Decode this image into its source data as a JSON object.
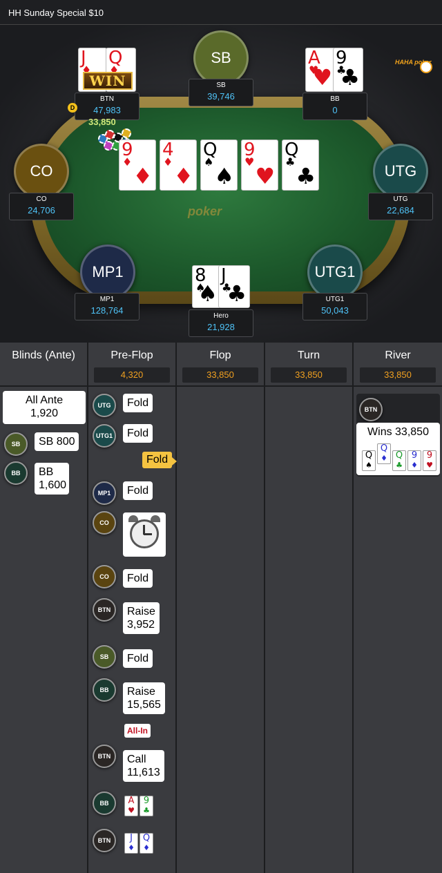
{
  "topbar": {
    "title": "HH  Sunday Special $10"
  },
  "logo": {
    "text": "HAHA poker"
  },
  "table": {
    "watermark": "poker",
    "pot_on_table": "33,850",
    "dealer_label": "D",
    "win_label": "WIN",
    "seats": {
      "btn": {
        "label": "BTN",
        "stack": "47,983"
      },
      "sb": {
        "circle": "SB",
        "label": "SB",
        "stack": "39,746"
      },
      "bb": {
        "label": "BB",
        "stack": "0"
      },
      "co": {
        "circle": "CO",
        "label": "CO",
        "stack": "24,706"
      },
      "utg": {
        "circle": "UTG",
        "label": "UTG",
        "stack": "22,684"
      },
      "mp1": {
        "circle": "MP1",
        "label": "MP1",
        "stack": "128,764"
      },
      "utg1": {
        "circle": "UTG1",
        "label": "UTG1",
        "stack": "50,043"
      },
      "hero": {
        "label": "Hero",
        "stack": "21,928"
      }
    },
    "btn_cards": [
      {
        "rank": "J",
        "suit": "♦"
      },
      {
        "rank": "Q",
        "suit": "♦"
      }
    ],
    "bb_cards": [
      {
        "rank": "A",
        "suit": "♥"
      },
      {
        "rank": "9",
        "suit": "♣"
      }
    ],
    "hero_cards": [
      {
        "rank": "8",
        "suit": "♠"
      },
      {
        "rank": "J",
        "suit": "♣"
      }
    ],
    "board": [
      {
        "rank": "9",
        "suit": "♦"
      },
      {
        "rank": "4",
        "suit": "♦"
      },
      {
        "rank": "Q",
        "suit": "♠"
      },
      {
        "rank": "9",
        "suit": "♥"
      },
      {
        "rank": "Q",
        "suit": "♣"
      }
    ]
  },
  "columns": {
    "blinds": {
      "title": "Blinds (Ante)"
    },
    "preflop": {
      "title": "Pre-Flop",
      "amount": "4,320"
    },
    "flop": {
      "title": "Flop",
      "amount": "33,850"
    },
    "turn": {
      "title": "Turn",
      "amount": "33,850"
    },
    "river": {
      "title": "River",
      "amount": "33,850"
    }
  },
  "blinds_actions": {
    "ante_line1": "All Ante",
    "ante_line2": "1,920",
    "sb_pos": "SB",
    "sb_text": "SB  800",
    "bb_pos": "BB",
    "bb_line1": "BB",
    "bb_line2": "1,600"
  },
  "preflop_actions": [
    {
      "pos": "UTG",
      "text": "Fold"
    },
    {
      "pos": "UTG1",
      "text": "Fold"
    },
    {
      "hero_text": "Fold"
    },
    {
      "pos": "MP1",
      "text": "Fold"
    },
    {
      "pos": "CO"
    },
    {
      "pos": "CO",
      "text": "Fold"
    },
    {
      "pos": "BTN",
      "line1": "Raise",
      "line2": "3,952"
    },
    {
      "pos": "SB",
      "text": "Fold"
    },
    {
      "pos": "BB",
      "line1": "Raise",
      "line2": "15,565",
      "tag": "All-In"
    },
    {
      "pos": "BTN",
      "line1": "Call",
      "line2": "11,613"
    },
    {
      "pos": "BB"
    },
    {
      "pos": "BTN"
    }
  ],
  "showdown": {
    "bb_cards": [
      {
        "rank": "A",
        "suit": "♥"
      },
      {
        "rank": "9",
        "suit": "♣"
      }
    ],
    "btn_cards": [
      {
        "rank": "J",
        "suit": "♦"
      },
      {
        "rank": "Q",
        "suit": "♦"
      }
    ]
  },
  "river": {
    "pos": "BTN",
    "text": "Wins 33,850",
    "cards": [
      {
        "rank": "Q",
        "suit": "♠"
      },
      {
        "rank": "Q",
        "suit": "♦"
      },
      {
        "rank": "Q",
        "suit": "♣"
      },
      {
        "rank": "9",
        "suit": "♦"
      },
      {
        "rank": "9",
        "suit": "♥"
      }
    ]
  },
  "colors": {
    "accent": "#f0a020",
    "stack": "#4fc3f7",
    "felt": "#1d5a2c"
  }
}
